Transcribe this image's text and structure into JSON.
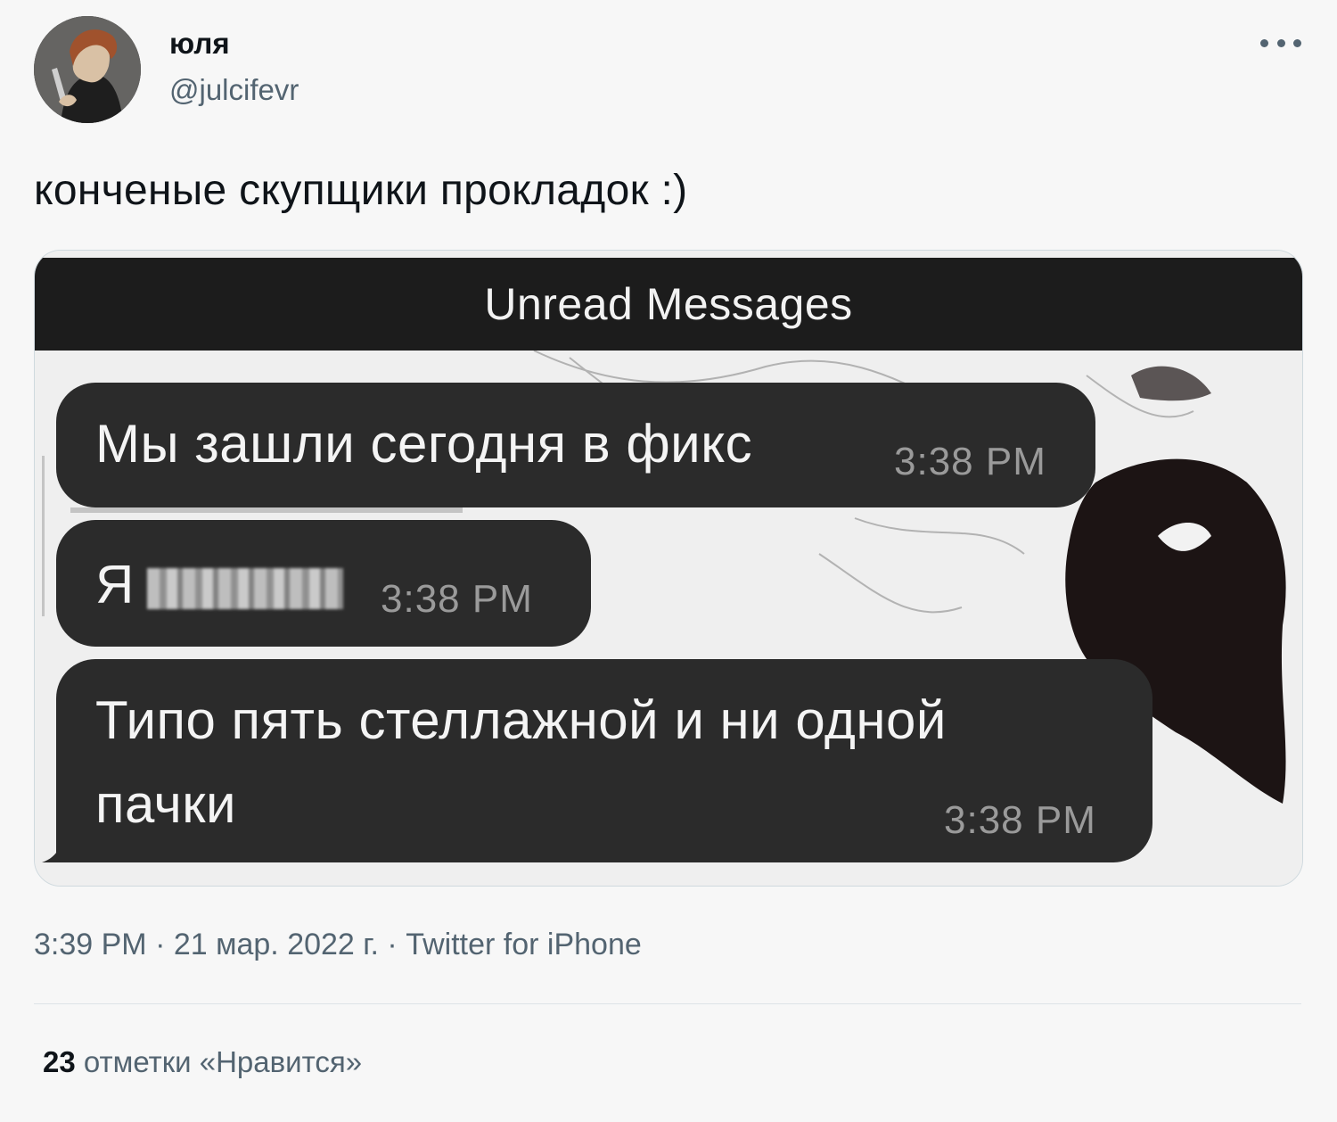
{
  "author": {
    "display_name": "юля",
    "handle": "@julcifevr",
    "avatar_icon": "avatar-illustration"
  },
  "menu_icon": "more-horizontal-icon",
  "tweet": {
    "text": "конченые скупщики прокладок :)"
  },
  "media": {
    "header": "Unread Messages",
    "messages": [
      {
        "text": "Мы зашли сегодня в фикс",
        "time": "3:38 PM"
      },
      {
        "text_prefix": "Я",
        "text_redacted": true,
        "time": "3:38 PM"
      },
      {
        "line1": "Типо пять стеллажной и ни одной",
        "line2": "пачки",
        "time": "3:38 PM"
      }
    ]
  },
  "meta": {
    "time": "3:39 PM",
    "sep1": " · ",
    "date": "21 мар. 2022 г.",
    "sep2": " · ",
    "source": "Twitter for iPhone"
  },
  "likes": {
    "count": "23",
    "label": " отметки «Нравится»"
  },
  "colors": {
    "background": "#f7f7f7",
    "bubble": "#2b2b2b",
    "secondary_text": "#536471"
  }
}
